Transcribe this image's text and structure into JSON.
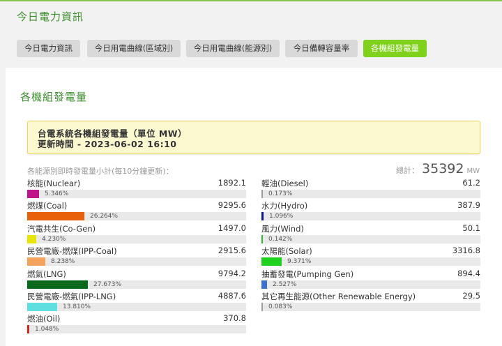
{
  "header": {
    "title": "今日電力資訊",
    "tabs": [
      {
        "label": "今日電力資訊",
        "active": false
      },
      {
        "label": "今日用電曲線(區域別)",
        "active": false
      },
      {
        "label": "今日用電曲線(能源別)",
        "active": false
      },
      {
        "label": "今日備轉容量率",
        "active": false
      },
      {
        "label": "各機組發電量",
        "active": true
      }
    ]
  },
  "section_title": "各機組發電量",
  "notice": {
    "line1": "台電系統各機組發電量（單位 MW）",
    "line2": "更新時間 - 2023-06-02 16:10"
  },
  "subtitle": "各能源別即時發電量小計(每10分鐘更新)：",
  "total": {
    "label": "總計：",
    "value": "35392",
    "unit": "MW"
  },
  "left_items": [
    {
      "name": "核能(Nuclear)",
      "value": "1892.1",
      "percent": "5.346%",
      "fraction": 0.05346,
      "color": "#c0148a"
    },
    {
      "name": "燃煤(Coal)",
      "value": "9295.6",
      "percent": "26.264%",
      "fraction": 0.26264,
      "color": "#e8600a"
    },
    {
      "name": "汽電共生(Co-Gen)",
      "value": "1497.0",
      "percent": "4.230%",
      "fraction": 0.0423,
      "color": "#e6e600"
    },
    {
      "name": "民營電廠-燃煤(IPP-Coal)",
      "value": "2915.6",
      "percent": "8.238%",
      "fraction": 0.08238,
      "color": "#f4a25c"
    },
    {
      "name": "燃氣(LNG)",
      "value": "9794.2",
      "percent": "27.673%",
      "fraction": 0.27673,
      "color": "#0a6a1c"
    },
    {
      "name": "民營電廠-燃氣(IPP-LNG)",
      "value": "4887.6",
      "percent": "13.810%",
      "fraction": 0.1381,
      "color": "#5ee0e0"
    },
    {
      "name": "燃油(Oil)",
      "value": "370.8",
      "percent": "1.048%",
      "fraction": 0.01048,
      "color": "#e02020"
    }
  ],
  "right_items": [
    {
      "name": "輕油(Diesel)",
      "value": "61.2",
      "percent": "0.173%",
      "fraction": 0.00173,
      "color": "#9c9c9c"
    },
    {
      "name": "水力(Hydro)",
      "value": "387.9",
      "percent": "1.096%",
      "fraction": 0.01096,
      "color": "#0a14a0"
    },
    {
      "name": "風力(Wind)",
      "value": "50.1",
      "percent": "0.142%",
      "fraction": 0.00142,
      "color": "#2eb82e"
    },
    {
      "name": "太陽能(Solar)",
      "value": "3316.8",
      "percent": "9.371%",
      "fraction": 0.09371,
      "color": "#1ed21e"
    },
    {
      "name": "抽蓄發電(Pumping Gen)",
      "value": "894.4",
      "percent": "2.527%",
      "fraction": 0.02527,
      "color": "#3a6fd8"
    },
    {
      "name": "其它再生能源(Other Renewable Energy)",
      "value": "29.5",
      "percent": "0.083%",
      "fraction": 0.00083,
      "color": "#9c9c9c"
    }
  ]
}
